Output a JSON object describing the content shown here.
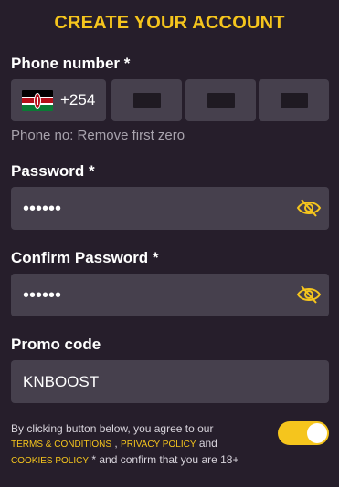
{
  "header": {
    "title": "CREATE YOUR ACCOUNT"
  },
  "phone": {
    "label": "Phone number *",
    "country_code": "+254",
    "flag_icon": "kenya-flag-icon",
    "hint": "Phone no: Remove first zero"
  },
  "password": {
    "label": "Password *",
    "value": "••••••",
    "toggle_icon": "eye-slash-icon"
  },
  "confirm_password": {
    "label": "Confirm Password *",
    "value": "••••••",
    "toggle_icon": "eye-slash-icon"
  },
  "promo": {
    "label": "Promo code",
    "value": "KNBOOST"
  },
  "terms": {
    "text_1": "By clicking button below, you agree to our",
    "link_terms": "TERMS & CONDITIONS",
    "sep_1": ",",
    "link_privacy": "PRIVACY POLICY",
    "sep_2": "and",
    "link_cookies": "COOKIES POLICY",
    "text_2": "* and confirm that you are 18+",
    "toggle_on": true
  },
  "colors": {
    "accent": "#f5c51d",
    "background": "#261e2b",
    "field": "#46404d"
  }
}
